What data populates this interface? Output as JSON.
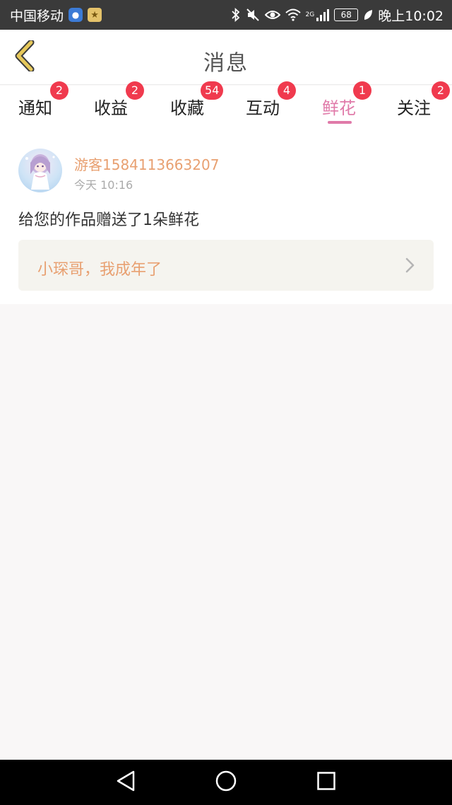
{
  "status_bar": {
    "carrier": "中国移动",
    "network_gen": "2G",
    "battery": "68",
    "time": "晚上10:02",
    "icons": [
      "shield-icon",
      "star-app-icon",
      "bluetooth-icon",
      "mute-icon",
      "eye-icon",
      "wifi-icon",
      "signal-icon",
      "battery-icon",
      "leaf-icon"
    ]
  },
  "header": {
    "title": "消息",
    "back_icon": "chevron-left-icon"
  },
  "tabs": [
    {
      "label": "通知",
      "badge": "2",
      "active": false
    },
    {
      "label": "收益",
      "badge": "2",
      "active": false
    },
    {
      "label": "收藏",
      "badge": "54",
      "active": false
    },
    {
      "label": "互动",
      "badge": "4",
      "active": false
    },
    {
      "label": "鲜花",
      "badge": "1",
      "active": true
    },
    {
      "label": "关注",
      "badge": "2",
      "active": false
    }
  ],
  "message": {
    "username": "游客1584113663207",
    "time": "今天 10:16",
    "text": "给您的作品赠送了1朵鲜花",
    "work_title": "小琛哥，我成年了"
  },
  "colors": {
    "accent_pink": "#e07aa9",
    "badge_red": "#f03a4e",
    "orange_text": "#e8a071",
    "back_arrow": "#e6c85a"
  },
  "nav_bar": {
    "icons": [
      "back-triangle-icon",
      "home-circle-icon",
      "recents-square-icon"
    ]
  }
}
